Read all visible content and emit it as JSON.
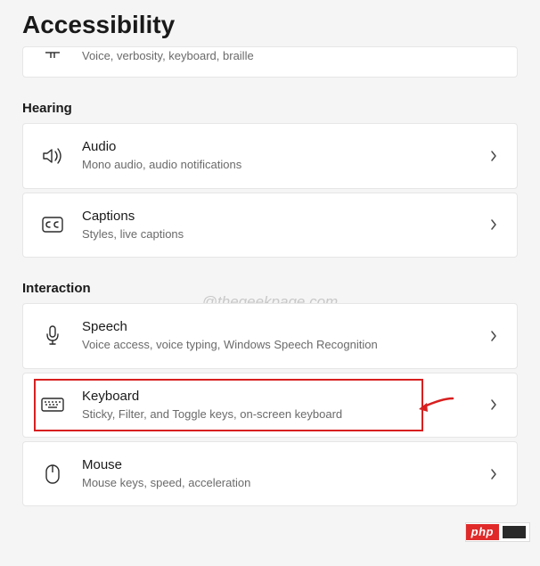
{
  "title": "Accessibility",
  "watermark": "@thegeekpage.com",
  "badge": "php",
  "sections": {
    "top": {
      "narrator": {
        "sub": "Voice, verbosity, keyboard, braille"
      }
    },
    "hearing": {
      "heading": "Hearing",
      "audio": {
        "title": "Audio",
        "sub": "Mono audio, audio notifications"
      },
      "captions": {
        "title": "Captions",
        "sub": "Styles, live captions"
      }
    },
    "interaction": {
      "heading": "Interaction",
      "speech": {
        "title": "Speech",
        "sub": "Voice access, voice typing, Windows Speech Recognition"
      },
      "keyboard": {
        "title": "Keyboard",
        "sub": "Sticky, Filter, and Toggle keys, on-screen keyboard"
      },
      "mouse": {
        "title": "Mouse",
        "sub": "Mouse keys, speed, acceleration"
      }
    }
  }
}
